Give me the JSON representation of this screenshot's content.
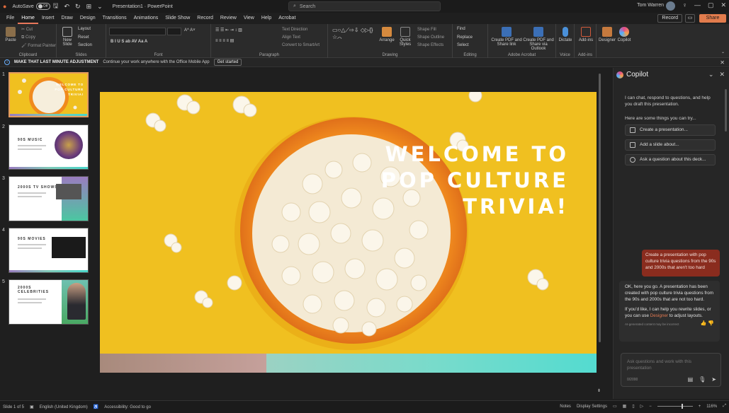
{
  "titlebar": {
    "autosave_label": "AutoSave",
    "autosave_state": "Off",
    "doc_title": "Presentation1 · PowerPoint",
    "search_placeholder": "Search",
    "user_name": "Tom Warren"
  },
  "menu": [
    "File",
    "Home",
    "Insert",
    "Draw",
    "Design",
    "Transitions",
    "Animations",
    "Slide Show",
    "Record",
    "Review",
    "View",
    "Help",
    "Acrobat"
  ],
  "menu_active": "Home",
  "header_buttons": {
    "record": "Record",
    "share": "Share"
  },
  "ribbon": {
    "groups": [
      "Clipboard",
      "Slides",
      "Font",
      "Paragraph",
      "Drawing",
      "Editing",
      "Adobe Acrobat",
      "Voice",
      "Add-ins"
    ],
    "paste": "Paste",
    "new_slide": "New Slide",
    "layout": "Layout",
    "reset": "Reset",
    "section": "Section",
    "arrange": "Arrange",
    "find": "Find",
    "replace": "Replace",
    "select": "Select",
    "create_pdf_link": "Create PDF and Share link",
    "create_pdf_outlook": "Create PDF and Share via Outlook",
    "dictate": "Dictate",
    "addins": "Add-ins",
    "designer": "Designer",
    "copilot": "Copilot"
  },
  "message_bar": {
    "title": "MAKE THAT LAST MINUTE ADJUSTMENT",
    "text": "Continue your work anywhere with the Office Mobile App",
    "button": "Get started"
  },
  "slides": [
    {
      "num": "1",
      "title": "WELCOME TO POP CULTURE TRIVIA!"
    },
    {
      "num": "2",
      "title": "90S MUSIC"
    },
    {
      "num": "3",
      "title": "2000S TV SHOWS"
    },
    {
      "num": "4",
      "title": "90S MOVIES"
    },
    {
      "num": "5",
      "title": "2000S CELEBRITIES"
    }
  ],
  "main_slide": {
    "title_lines": [
      "WELCOME TO",
      "POP CULTURE",
      "TRIVIA!"
    ]
  },
  "copilot": {
    "title": "Copilot",
    "intro": "I can chat, respond to questions, and help you draft this presentation.",
    "things": "Here are some things you can try...",
    "suggestions": [
      "Create a presentation...",
      "Add a slide about...",
      "Ask a question about this deck..."
    ],
    "user_msg": "Create a presentation with pop culture trivia questions from the 90s and 2000s that aren't too hard",
    "reply_p1": "OK, here you go. A presentation has been created with pop culture trivia questions from the 90s and 2000s that are not too hard.",
    "reply_p2_a": "If you'd like, I can help you rewrite slides, or you can use ",
    "reply_p2_link": "Designer",
    "reply_p2_b": " to adjust layouts.",
    "ai_note": "AI-generated content may be incorrect",
    "input_placeholder": "Ask questions and work with this presentation",
    "char_count": "0/2000"
  },
  "status": {
    "slide_of": "Slide 1 of 5",
    "language": "English (United Kingdom)",
    "accessibility": "Accessibility: Good to go",
    "notes": "Notes",
    "display": "Display Settings",
    "zoom": "116%"
  }
}
